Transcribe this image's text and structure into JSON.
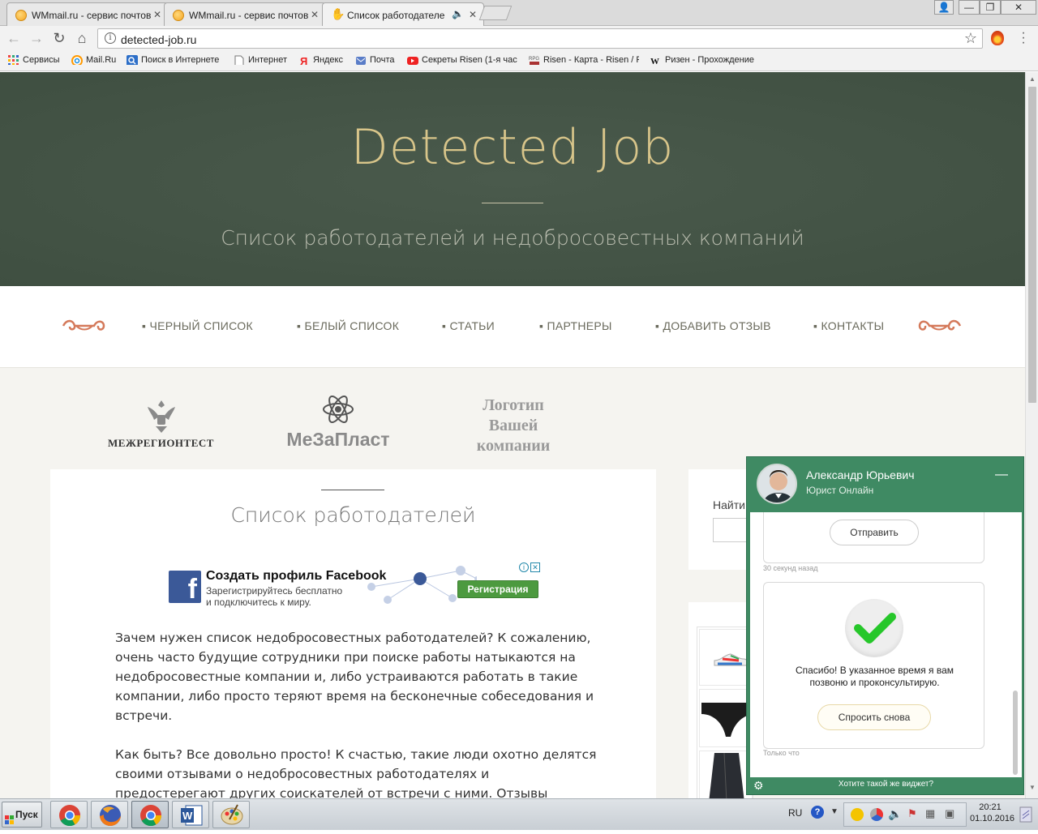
{
  "browser": {
    "tabs": [
      {
        "title": "WMmail.ru - сервис почтов"
      },
      {
        "title": "WMmail.ru - сервис почтов"
      },
      {
        "title": "Список работодателе"
      }
    ],
    "url": "detected-job.ru",
    "bookmarks": [
      {
        "label": "Сервисы",
        "icon": "apps-grid-icon"
      },
      {
        "label": "Mail.Ru",
        "icon": "mailru-icon"
      },
      {
        "label": "Поиск в Интернете",
        "icon": "search-icon"
      },
      {
        "label": "Интернет",
        "icon": "page-icon"
      },
      {
        "label": "Яндекс",
        "icon": "yandex-icon"
      },
      {
        "label": "Почта",
        "icon": "mail-icon"
      },
      {
        "label": "Секреты Risen (1-я час",
        "icon": "youtube-icon"
      },
      {
        "label": "Risen - Карта - Risen / F",
        "icon": "rpg-icon"
      },
      {
        "label": "Ризен - Прохождение",
        "icon": "wp-icon"
      }
    ]
  },
  "site": {
    "title": "Detected Job",
    "subtitle": "Список работодателей и недобросовестных компаний",
    "nav": [
      "ЧЕРНЫЙ СПИСОК",
      "БЕЛЫЙ СПИСОК",
      "СТАТЬИ",
      "ПАРТНЕРЫ",
      "ДОБАВИТЬ ОТЗЫВ",
      "КОНТАКТЫ"
    ],
    "partners": {
      "p1": "МЕЖРЕГИОНТЕСТ",
      "p2": "МеЗаПласт",
      "p3_l1": "Логотип",
      "p3_l2": "Вашей",
      "p3_l3": "компании"
    },
    "heading": "Список работодателей",
    "ad": {
      "title": "Создать профиль Facebook",
      "line1": "Зарегистрируйтесь бесплатно",
      "line2": "и подключитесь к миру.",
      "button": "Регистрация"
    },
    "paragraphs": [
      "Зачем нужен список недобросовестных работодателей? К сожалению, очень часто будущие сотрудники при поиске работы натыкаются на недобросовестные компании и, либо устраиваются работать в такие компании, либо просто теряют время на бесконечные собеседования и встречи.",
      "Как быть? Все довольно просто! К счастью, такие люди охотно делятся своими отзывами о недобросовестных работодателях и предостерегают других соискателей от встречи с ними. Отзывы попадают в список"
    ],
    "search_label": "Найти"
  },
  "chat": {
    "name": "Александр Юрьевич",
    "role": "Юрист Онлайн",
    "send_button": "Отправить",
    "time1": "30 секунд назад",
    "thanks_l1": "Спасибо! В указанное время я вам",
    "thanks_l2": "позвоню и проконсультирую.",
    "ask_again_button": "Спросить снова",
    "time2": "Только что",
    "footer": "Хотите такой же виджет?"
  },
  "taskbar": {
    "start": "Пуск",
    "lang": "RU",
    "time": "20:21",
    "date": "01.10.2016"
  },
  "colors": {
    "hero_bg": "#4a5a4c",
    "title_gold": "#d8c58a",
    "accent_orange": "#d4795a",
    "chat_green": "#3f8a63",
    "fb_blue": "#3b5998"
  }
}
